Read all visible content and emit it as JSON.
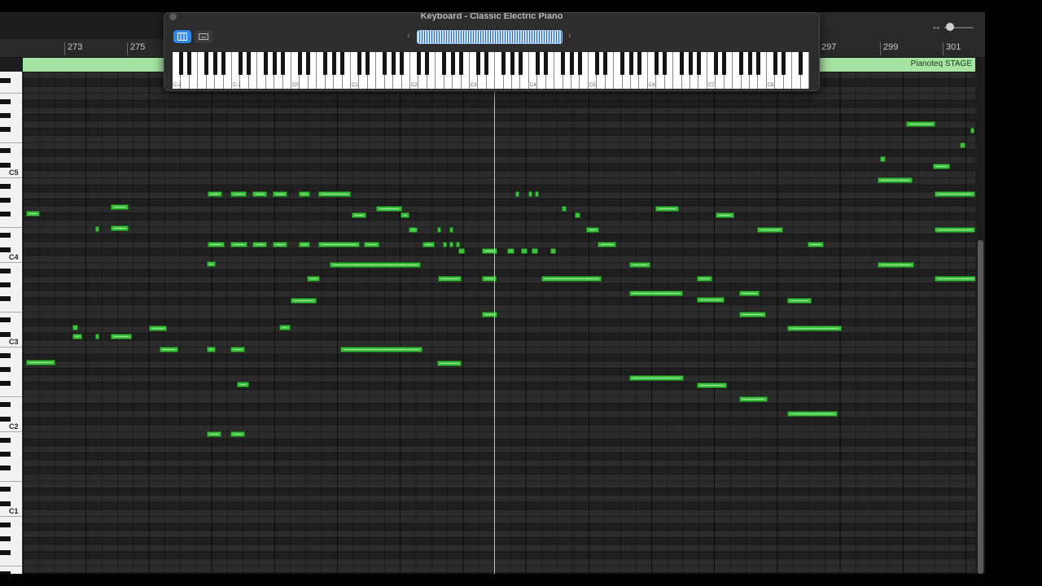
{
  "keyboard_window": {
    "title": "Keyboard - Classic Electric Piano",
    "mode_buttons": [
      {
        "icon": "piano-keys-icon",
        "active": true
      },
      {
        "icon": "qwerty-keyboard-icon",
        "active": false
      }
    ],
    "range_left_icon": "chevron-left-icon",
    "range_right_icon": "chevron-right-icon",
    "octave_labels": [
      "C-2",
      "C-1",
      "C0",
      "C1",
      "C2",
      "C3",
      "C4",
      "C5",
      "C6",
      "C7",
      "C8"
    ]
  },
  "ruler": {
    "bars_left": [
      "273",
      "275"
    ],
    "bars_right": [
      "297",
      "299",
      "301"
    ]
  },
  "region": {
    "name": "Pianoteq STAGE"
  },
  "zoom": {
    "icon": "horizontal-zoom-icon",
    "level": 0.2
  },
  "piano_roll": {
    "octave_labels": [
      "C5",
      "C4",
      "C3",
      "C2",
      "C1",
      "C0"
    ],
    "playhead_bar": 286.7,
    "notes": [
      {
        "bar": 272.1,
        "len": 0.45,
        "pitch": "C2"
      },
      {
        "bar": 272.1,
        "len": 0.2,
        "pitch": "G#2"
      },
      {
        "bar": 272.9,
        "len": 0.05,
        "pitch": "C#2"
      },
      {
        "bar": 272.85,
        "len": 0.1,
        "pitch": "G1"
      },
      {
        "bar": 273.5,
        "len": 0.12,
        "pitch": "D1"
      },
      {
        "bar": 273.45,
        "len": 0.1,
        "pitch": "B1"
      },
      {
        "bar": 273.4,
        "len": 0.1,
        "pitch": "A1"
      },
      {
        "bar": 274.0,
        "len": 0.1,
        "pitch": "F#2"
      },
      {
        "bar": 274.1,
        "len": 0.1,
        "pitch": "A1"
      },
      {
        "bar": 274.2,
        "len": 0.05,
        "pitch": "D2"
      },
      {
        "bar": 274.2,
        "len": 0.08,
        "pitch": "F1"
      },
      {
        "bar": 274.6,
        "len": 0.5,
        "pitch": "A#2"
      },
      {
        "bar": 274.6,
        "len": 0.5,
        "pitch": "D#2"
      },
      {
        "bar": 274.6,
        "len": 0.5,
        "pitch": "F1"
      },
      {
        "bar": 274.6,
        "len": 0.5,
        "pitch": "A1"
      },
      {
        "bar": 274.6,
        "len": 0.5,
        "pitch": "D#2"
      }
    ]
  }
}
